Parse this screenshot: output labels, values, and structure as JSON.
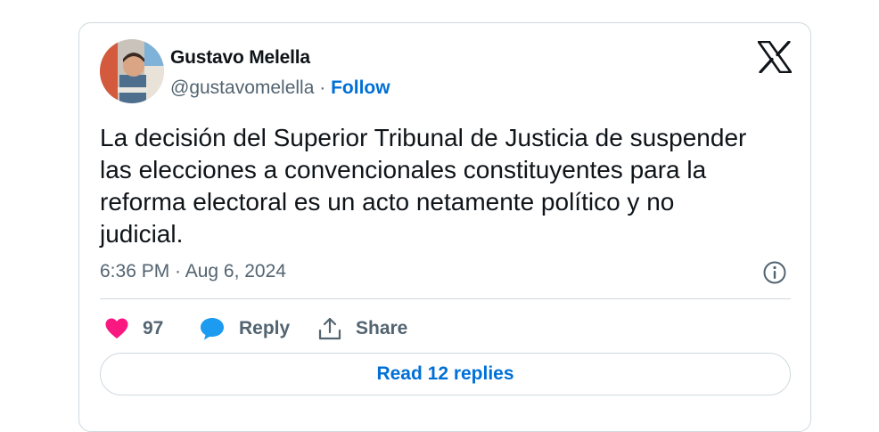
{
  "author": {
    "name": "Gustavo Melella",
    "handle": "@gustavomelella",
    "separator": " · ",
    "follow_label": "Follow"
  },
  "tweet": {
    "text": "La decisión del Superior Tribunal de Justicia de suspender\nlas elecciones a convencionales constituyentes para la\nreforma electoral es un acto netamente político y no\njudicial.",
    "timestamp": "6:36 PM · Aug 6, 2024"
  },
  "actions": {
    "like_count": "97",
    "reply_label": "Reply",
    "share_label": "Share"
  },
  "read_replies_label": "Read 12 replies",
  "icons": {
    "brand": "x-logo-icon",
    "info": "info-icon",
    "like": "heart-icon",
    "reply": "speech-bubble-icon",
    "share": "share-upload-icon"
  },
  "colors": {
    "link": "#006fd6",
    "like": "#f91880",
    "reply": "#1d9bf0",
    "secondary_text": "#536471",
    "border": "#cfd9de"
  }
}
